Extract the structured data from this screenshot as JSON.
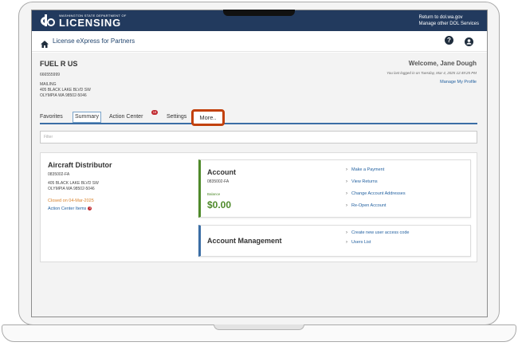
{
  "banner": {
    "logo_small": "WASHINGTON STATE DEPARTMENT OF",
    "logo_big": "LICENSING",
    "links": [
      "Return to dol.wa.gov",
      "Manage other DOL Services"
    ]
  },
  "appbar": {
    "title": "License eXpress for Partners",
    "icons": [
      "home-icon",
      "help-icon",
      "user-icon"
    ],
    "help_glyph": "?"
  },
  "account": {
    "name": "FUEL R US",
    "id": "666555999",
    "address_lines": [
      "MAILING",
      "405 BLACK LAKE BLVD SW",
      "OLYMPIA WA 98502-5046"
    ]
  },
  "user": {
    "welcome": "Welcome, Jane Dough",
    "last_login": "You last logged in on Tuesday, Mar 4, 2025 12:49:25 PM",
    "manage_profile": "Manage My Profile"
  },
  "tabs": [
    {
      "label": "Favorites",
      "active": false
    },
    {
      "label": "Summary",
      "active": true
    },
    {
      "label": "Action Center",
      "active": false,
      "badge": "15"
    },
    {
      "label": "Settings",
      "active": false
    },
    {
      "label": "More..",
      "active": false,
      "highlighted": true
    }
  ],
  "filter": {
    "placeholder": "Filter"
  },
  "license": {
    "title": "Aircraft Distributor",
    "id": "0835002-FA",
    "address_lines": [
      "405 BLACK LAKE BLVD SW",
      "OLYMPIA WA 98502-5046"
    ],
    "status": "Closed on 04-Mar-2025",
    "action_items": "Action Center Items",
    "action_items_count": "3"
  },
  "account_box": {
    "title": "Account",
    "id": "0835002-FA",
    "balance_label": "Balance",
    "balance_value": "$0.00",
    "links": [
      "Make a Payment",
      "View Returns",
      "Change Account Addresses",
      "Re-Open Account"
    ]
  },
  "mgmt_box": {
    "title": "Account Management",
    "links": [
      "Create new user access code",
      "Users List"
    ]
  },
  "colors": {
    "banner": "#223a5e",
    "accent": "#3b6ea5",
    "balance_green": "#4f8a2b",
    "highlight": "#c2410c",
    "badge_red": "#c0282e"
  }
}
